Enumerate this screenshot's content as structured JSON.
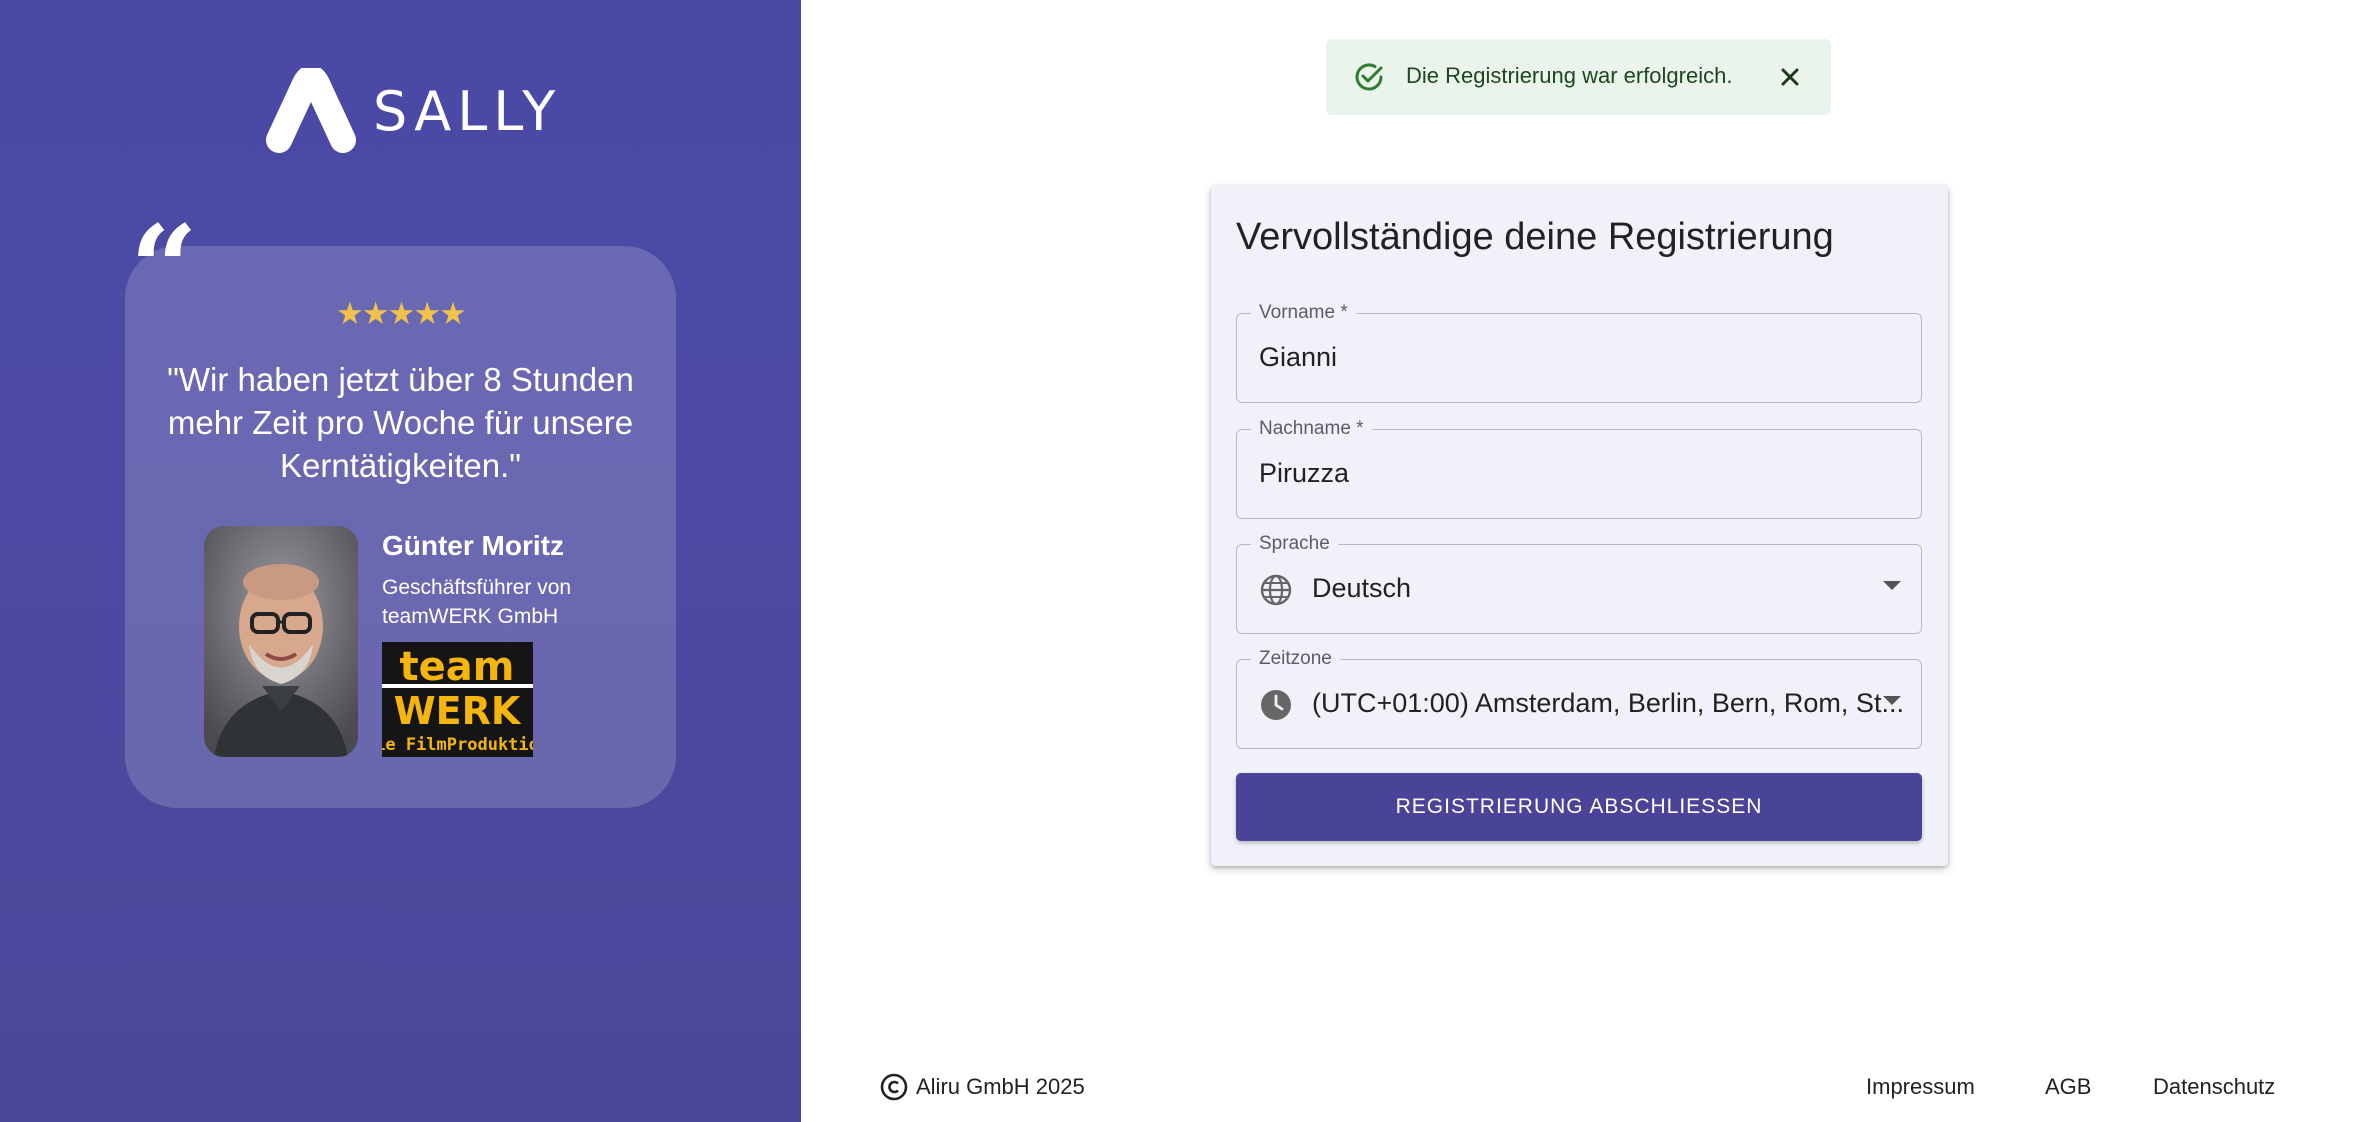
{
  "brand": {
    "name": "SALLY"
  },
  "testimonial": {
    "stars": "★★★★★",
    "rating": 5,
    "quote": "\"Wir haben jetzt über 8 Stunden mehr Zeit pro Woche für unsere Kerntätigkeiten.\"",
    "name": "Günter Moritz",
    "role": "Geschäftsführer von teamWERK GmbH",
    "company_logo": {
      "line1": "team",
      "line2": "WERK",
      "line3": "Die FilmProduktion"
    }
  },
  "toast": {
    "message": "Die Registrierung war erfolgreich.",
    "icon": "check-circle-icon",
    "close_icon": "close-icon"
  },
  "form": {
    "title": "Vervollständige deine Registrierung",
    "fields": {
      "first_name": {
        "label": "Vorname *",
        "value": "Gianni"
      },
      "last_name": {
        "label": "Nachname *",
        "value": "Piruzza"
      },
      "language": {
        "label": "Sprache",
        "value": "Deutsch",
        "icon": "globe-icon"
      },
      "timezone": {
        "label": "Zeitzone",
        "value": "(UTC+01:00) Amsterdam, Berlin, Bern, Rom, St...",
        "icon": "clock-icon"
      }
    },
    "submit_label": "REGISTRIERUNG ABSCHLIESSEN"
  },
  "footer": {
    "copyright": "Aliru GmbH 2025",
    "links": [
      "Impressum",
      "AGB",
      "Datenschutz"
    ]
  },
  "colors": {
    "panel": "#4a49a6",
    "accent": "#4a4498",
    "star": "#f2c14c",
    "toast_bg": "#eaf4ea",
    "toast_icon": "#2e7d32"
  }
}
